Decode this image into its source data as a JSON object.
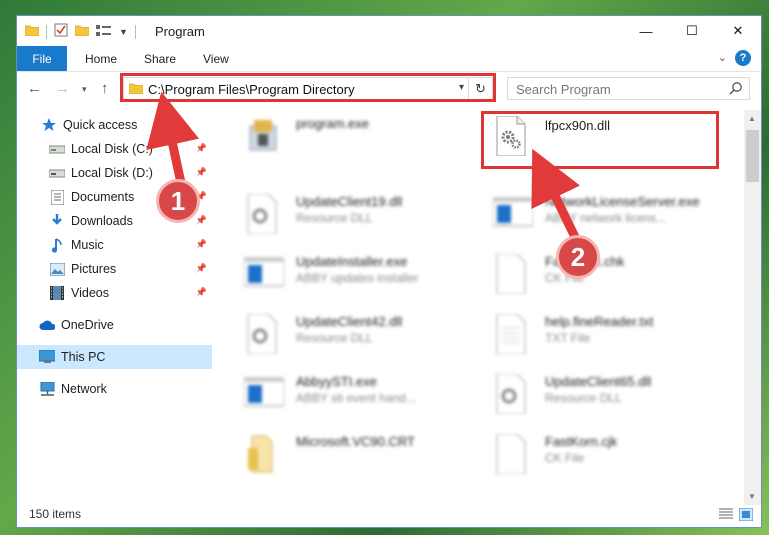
{
  "window": {
    "title": "Program",
    "controls": {
      "minimize": "—",
      "maximize": "☐",
      "close": "✕"
    }
  },
  "ribbon": {
    "file": "File",
    "tabs": [
      "Home",
      "Share",
      "View"
    ],
    "help": "?"
  },
  "addressbar": {
    "path": "C:\\Program Files\\Program Directory",
    "refresh": "↻"
  },
  "search": {
    "placeholder": "Search Program"
  },
  "sidebar": {
    "items": [
      {
        "label": "Quick access",
        "icon": "star-icon",
        "pinned": false
      },
      {
        "label": "Local Disk (C:)",
        "icon": "drive-icon",
        "pinned": true
      },
      {
        "label": "Local Disk (D:)",
        "icon": "drive-icon",
        "pinned": true
      },
      {
        "label": "Documents",
        "icon": "documents-icon",
        "pinned": true
      },
      {
        "label": "Downloads",
        "icon": "download-icon",
        "pinned": true
      },
      {
        "label": "Music",
        "icon": "music-icon",
        "pinned": true
      },
      {
        "label": "Pictures",
        "icon": "pictures-icon",
        "pinned": true
      },
      {
        "label": "Videos",
        "icon": "videos-icon",
        "pinned": true
      },
      {
        "label": "OneDrive",
        "icon": "cloud-icon",
        "pinned": false
      },
      {
        "label": "This PC",
        "icon": "computer-icon",
        "pinned": false,
        "selected": true
      },
      {
        "label": "Network",
        "icon": "network-icon",
        "pinned": false
      }
    ]
  },
  "files": [
    {
      "name": "program.exe",
      "desc": "",
      "icon": "exe-app-icon"
    },
    {
      "name": "lfpcx90n.dll",
      "desc": "",
      "icon": "dll-gears-icon"
    },
    {
      "name": "UpdateClient19.dll",
      "desc": "Resource DLL",
      "icon": "dll-gears-icon"
    },
    {
      "name": "NetworkLicenseServer.exe",
      "desc": "ABBY network licens...",
      "icon": "exe-window-icon"
    },
    {
      "name": "UpdateInstaller.exe",
      "desc": "ABBY updates installer",
      "icon": "exe-window-icon"
    },
    {
      "name": "FastHook.chk",
      "desc": "CK File",
      "icon": "blank-file-icon"
    },
    {
      "name": "UpdateClient42.dll",
      "desc": "Resource DLL",
      "icon": "dll-gears-icon"
    },
    {
      "name": "help.fineReader.txt",
      "desc": "TXT File",
      "icon": "text-file-icon"
    },
    {
      "name": "AbbyySTI.exe",
      "desc": "ABBY sti event hand...",
      "icon": "exe-window-icon"
    },
    {
      "name": "UpdateClient65.dll",
      "desc": "Resource DLL",
      "icon": "dll-gears-icon"
    },
    {
      "name": "Microsoft.VC90.CRT",
      "desc": "",
      "icon": "folder-icon"
    },
    {
      "name": "FastKorn.cjk",
      "desc": "CK File",
      "icon": "blank-file-icon"
    }
  ],
  "status": {
    "items": "150 items"
  },
  "annotations": {
    "step1": "1",
    "step2": "2"
  },
  "colors": {
    "accent": "#1979ca",
    "highlight": "#e13434",
    "callout": "#d94848",
    "selection": "#cce8ff"
  }
}
